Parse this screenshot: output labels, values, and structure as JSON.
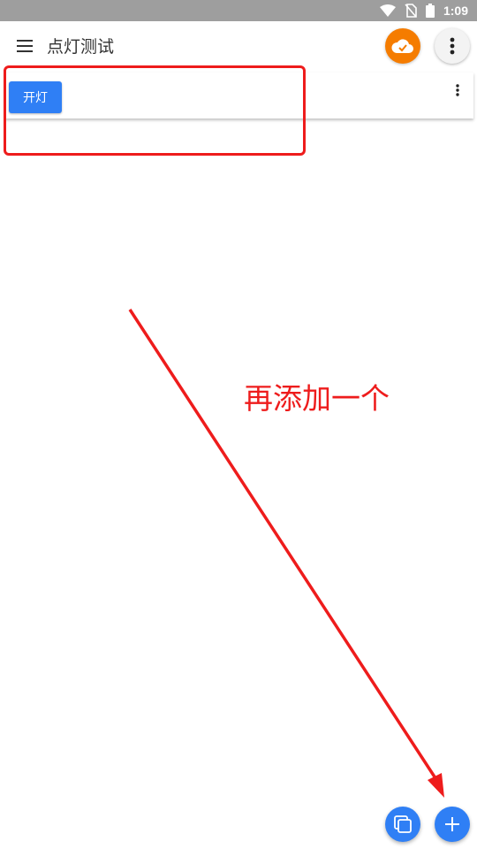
{
  "status_bar": {
    "time": "1:09"
  },
  "app_bar": {
    "title": "点灯测试"
  },
  "card": {
    "button_label": "开灯"
  },
  "annotation": {
    "text": "再添加一个",
    "color": "#ee1c1c"
  },
  "colors": {
    "accent": "#2f7ff5",
    "cloud": "#f57c00"
  },
  "icons": [
    "wifi-icon",
    "no-sim-icon",
    "battery-icon",
    "menu-icon",
    "cloud-check-icon",
    "more-vert-icon",
    "copy-icon",
    "add-icon"
  ]
}
